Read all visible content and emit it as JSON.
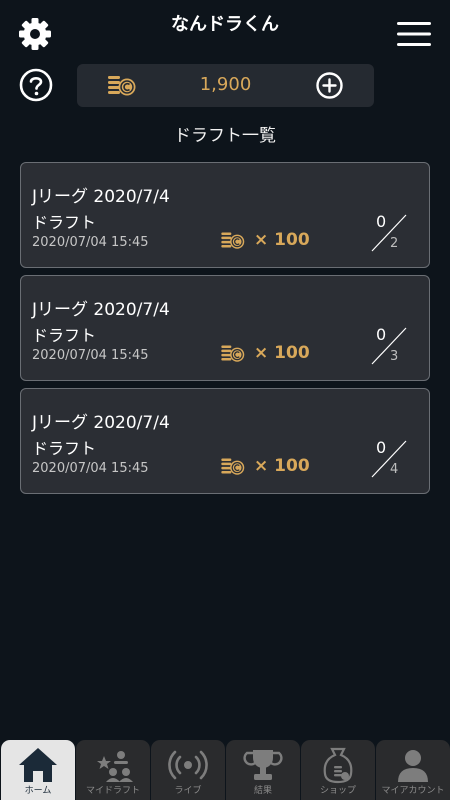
{
  "header": {
    "title": "なんドラくん",
    "balance": "1,900"
  },
  "section_title": "ドラフト一覧",
  "drafts": [
    {
      "title": "Jリーグ 2020/7/4",
      "subtitle": "ドラフト",
      "datetime": "2020/07/04 15:45",
      "cost": "× 100",
      "current": "0",
      "max": "2"
    },
    {
      "title": "Jリーグ 2020/7/4",
      "subtitle": "ドラフト",
      "datetime": "2020/07/04 15:45",
      "cost": "× 100",
      "current": "0",
      "max": "3"
    },
    {
      "title": "Jリーグ 2020/7/4",
      "subtitle": "ドラフト",
      "datetime": "2020/07/04 15:45",
      "cost": "× 100",
      "current": "0",
      "max": "4"
    }
  ],
  "nav": [
    {
      "label": "ホーム",
      "icon": "home-icon",
      "active": true
    },
    {
      "label": "マイドラフト",
      "icon": "my-draft-icon",
      "active": false
    },
    {
      "label": "ライブ",
      "icon": "live-icon",
      "active": false
    },
    {
      "label": "結果",
      "icon": "trophy-icon",
      "active": false
    },
    {
      "label": "ショップ",
      "icon": "shop-icon",
      "active": false
    },
    {
      "label": "マイアカウント",
      "icon": "account-icon",
      "active": false
    }
  ],
  "colors": {
    "background": "#0d141b",
    "card": "#2b2e34",
    "accent_gold": "#d8a85a",
    "nav_active": "#e5e5e5",
    "nav_inactive": "#2a2b2d"
  }
}
